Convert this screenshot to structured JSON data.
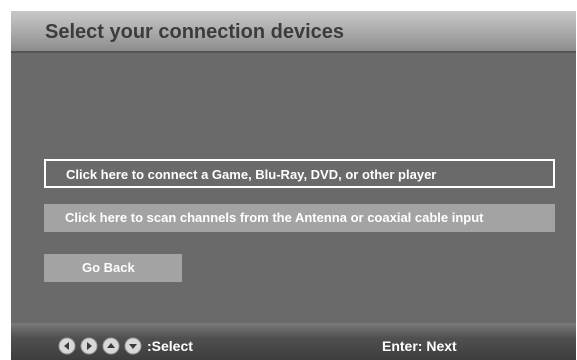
{
  "header": {
    "title": "Select your connection devices"
  },
  "options": {
    "player_label": "Click here to connect a Game, Blu-Ray, DVD, or other player",
    "scan_label": "Click here to scan channels from the Antenna or coaxial cable input",
    "back_label": "Go Back"
  },
  "footer": {
    "nav_icons": [
      "arrow-left-icon",
      "arrow-right-icon",
      "arrow-up-icon",
      "arrow-down-icon"
    ],
    "select_label": ":Select",
    "enter_label": "Enter: Next"
  },
  "colors": {
    "background": "#6a6a6a",
    "button_fill": "#a3a3a3",
    "selected_border": "#ffffff",
    "text": "#ffffff"
  }
}
